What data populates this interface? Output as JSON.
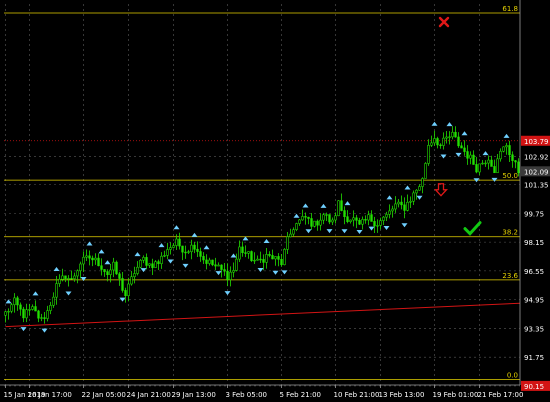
{
  "chart_data": {
    "type": "candlestick",
    "title": "",
    "colors": {
      "background": "#000000",
      "grid": "#5a5a5a",
      "candle": "#22e000",
      "fractal_up": "#6fd0ff",
      "fibo": "#e6d200",
      "trendline": "#d21414",
      "current_price_label": "#3a3a3a",
      "resistance_label": "#d21414",
      "checkmark": "#12c912",
      "cross": "#e01818",
      "down_arrow": "#e01818"
    },
    "ylim": [
      90.2,
      111.4
    ],
    "y_ticks": [
      "102.92",
      "101.35",
      "99.75",
      "98.15",
      "96.55",
      "94.95",
      "93.35",
      "91.75",
      "90.15",
      "102.09"
    ],
    "y_tick_values": [
      102.92,
      101.35,
      99.75,
      98.15,
      96.55,
      94.95,
      93.35,
      91.75,
      90.15,
      102.09
    ],
    "x_ticks": [
      "15 Jan 2019",
      "16 Jan 17:00",
      "22 Jan 05:00",
      "24 Jan 21:00",
      "29 Jan 13:00",
      "3 Feb 05:00",
      "5 Feb 21:00",
      "10 Feb 21:00",
      "13 Feb 13:00",
      "19 Feb 01:00",
      "21 Feb 17:00"
    ],
    "x_tick_bar_index": [
      0,
      8,
      26,
      41,
      56,
      74,
      92,
      110,
      125,
      143,
      158
    ],
    "bar_count": 172,
    "price_labels": {
      "current": "102.09",
      "resistance": "103.79",
      "support": "90.15"
    },
    "fibo_levels": [
      {
        "label": "61.8",
        "value": 110.9
      },
      {
        "label": "50.0",
        "value": 101.6
      },
      {
        "label": "38.2",
        "value": 98.45
      },
      {
        "label": "23.6",
        "value": 96.05
      },
      {
        "label": "0.0",
        "value": 90.5
      }
    ],
    "resistance_line": 103.79,
    "trendline": {
      "from_bar": 0,
      "from_value": 93.45,
      "to_bar": 171,
      "to_value": 94.75
    },
    "close_path": [
      [
        0,
        94.2
      ],
      [
        3,
        94.8
      ],
      [
        6,
        94.1
      ],
      [
        9,
        94.4
      ],
      [
        12,
        93.8
      ],
      [
        14,
        94.3
      ],
      [
        17,
        95.7
      ],
      [
        20,
        96.3
      ],
      [
        22,
        96.0
      ],
      [
        25,
        97.0
      ],
      [
        28,
        97.3
      ],
      [
        31,
        97.0
      ],
      [
        34,
        96.4
      ],
      [
        36,
        96.8
      ],
      [
        38,
        96.0
      ],
      [
        40,
        95.2
      ],
      [
        43,
        96.5
      ],
      [
        46,
        97.2
      ],
      [
        48,
        96.9
      ],
      [
        51,
        97.0
      ],
      [
        54,
        97.8
      ],
      [
        57,
        98.1
      ],
      [
        60,
        97.7
      ],
      [
        63,
        98.0
      ],
      [
        66,
        97.2
      ],
      [
        68,
        97.0
      ],
      [
        71,
        96.7
      ],
      [
        74,
        96.3
      ],
      [
        76,
        96.6
      ],
      [
        78,
        97.8
      ],
      [
        81,
        97.4
      ],
      [
        84,
        97.0
      ],
      [
        87,
        97.4
      ],
      [
        90,
        97.2
      ],
      [
        92,
        97.0
      ],
      [
        94,
        98.2
      ],
      [
        96,
        99.0
      ],
      [
        98,
        99.3
      ],
      [
        100,
        99.5
      ],
      [
        103,
        99.1
      ],
      [
        106,
        99.7
      ],
      [
        109,
        99.2
      ],
      [
        111,
        100.3
      ],
      [
        113,
        99.6
      ],
      [
        116,
        99.4
      ],
      [
        118,
        99.0
      ],
      [
        121,
        99.5
      ],
      [
        124,
        99.2
      ],
      [
        127,
        99.6
      ],
      [
        130,
        100.2
      ],
      [
        133,
        100.1
      ],
      [
        136,
        100.8
      ],
      [
        139,
        101.6
      ],
      [
        141,
        103.6
      ],
      [
        143,
        104.0
      ],
      [
        145,
        103.5
      ],
      [
        147,
        103.9
      ],
      [
        149,
        104.1
      ],
      [
        151,
        103.6
      ],
      [
        153,
        103.2
      ],
      [
        155,
        102.8
      ],
      [
        157,
        102.3
      ],
      [
        159,
        102.6
      ],
      [
        161,
        102.9
      ],
      [
        163,
        102.2
      ],
      [
        165,
        103.1
      ],
      [
        167,
        103.6
      ],
      [
        169,
        102.7
      ],
      [
        171,
        102.1
      ]
    ],
    "fractal_up_bars": [
      1,
      10,
      17,
      28,
      32,
      34,
      44,
      52,
      57,
      63,
      67,
      76,
      80,
      87,
      97,
      100,
      106,
      114,
      128,
      134,
      143,
      148,
      153,
      160,
      167
    ],
    "fractal_down_bars": [
      6,
      13,
      21,
      26,
      39,
      46,
      55,
      60,
      71,
      74,
      85,
      90,
      93,
      101,
      108,
      113,
      118,
      122,
      127,
      133,
      138,
      146,
      151,
      157,
      163
    ]
  }
}
